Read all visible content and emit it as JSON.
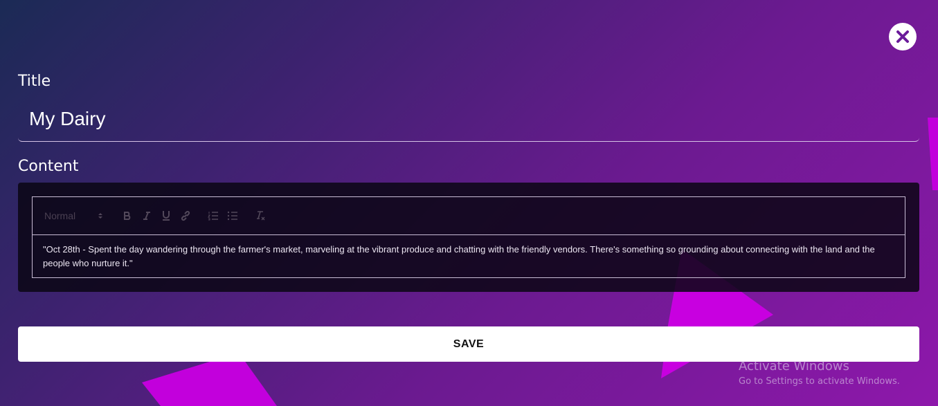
{
  "form": {
    "title_label": "Title",
    "title_value": "My Dairy",
    "content_label": "Content",
    "save_label": "SAVE"
  },
  "editor": {
    "format_select": "Normal",
    "toolbar_icons": [
      "bold-icon",
      "italic-icon",
      "underline-icon",
      "link-icon",
      "ordered-list-icon",
      "bullet-list-icon",
      "clear-format-icon"
    ],
    "body_text": "\"Oct 28th - Spent the day wandering through the farmer's market, marveling at the vibrant produce and chatting with the friendly vendors. There's something so grounding about connecting with the land and the people who nurture it.\""
  },
  "close_button": {
    "icon": "close-icon"
  },
  "watermark": {
    "title": "Activate Windows",
    "subtitle": "Go to Settings to activate Windows."
  },
  "colors": {
    "bg_start": "#1b2a55",
    "bg_end": "#8e18ab",
    "accent": "#7a1fa2",
    "shape": "#c800e0",
    "editor_bg": "#0a0614"
  }
}
